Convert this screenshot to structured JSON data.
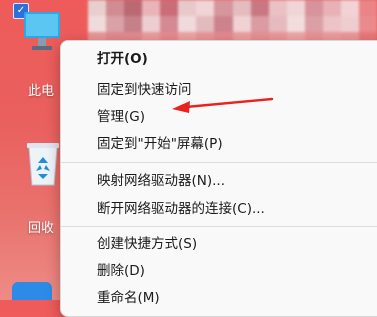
{
  "desktop": {
    "this_pc_label": "此电",
    "recycle_bin_label": "回收"
  },
  "context_menu": {
    "items": [
      {
        "label": "打开(O)"
      },
      {
        "label": "固定到快速访问"
      },
      {
        "label": "管理(G)"
      },
      {
        "label": "固定到\"开始\"屏幕(P)"
      },
      {
        "label": "映射网络驱动器(N)..."
      },
      {
        "label": "断开网络驱动器的连接(C)..."
      },
      {
        "label": "创建快捷方式(S)"
      },
      {
        "label": "删除(D)"
      },
      {
        "label": "重命名(M)"
      }
    ]
  },
  "colors": {
    "desktop_bg": "#ec5f5d",
    "menu_bg": "#f9f9f9",
    "arrow": "#e8231f",
    "checkbox": "#2f6fd8"
  },
  "icons": [
    "this-pc-icon",
    "recycle-bin-icon",
    "checkbox-icon",
    "red-arrow-annotation"
  ]
}
